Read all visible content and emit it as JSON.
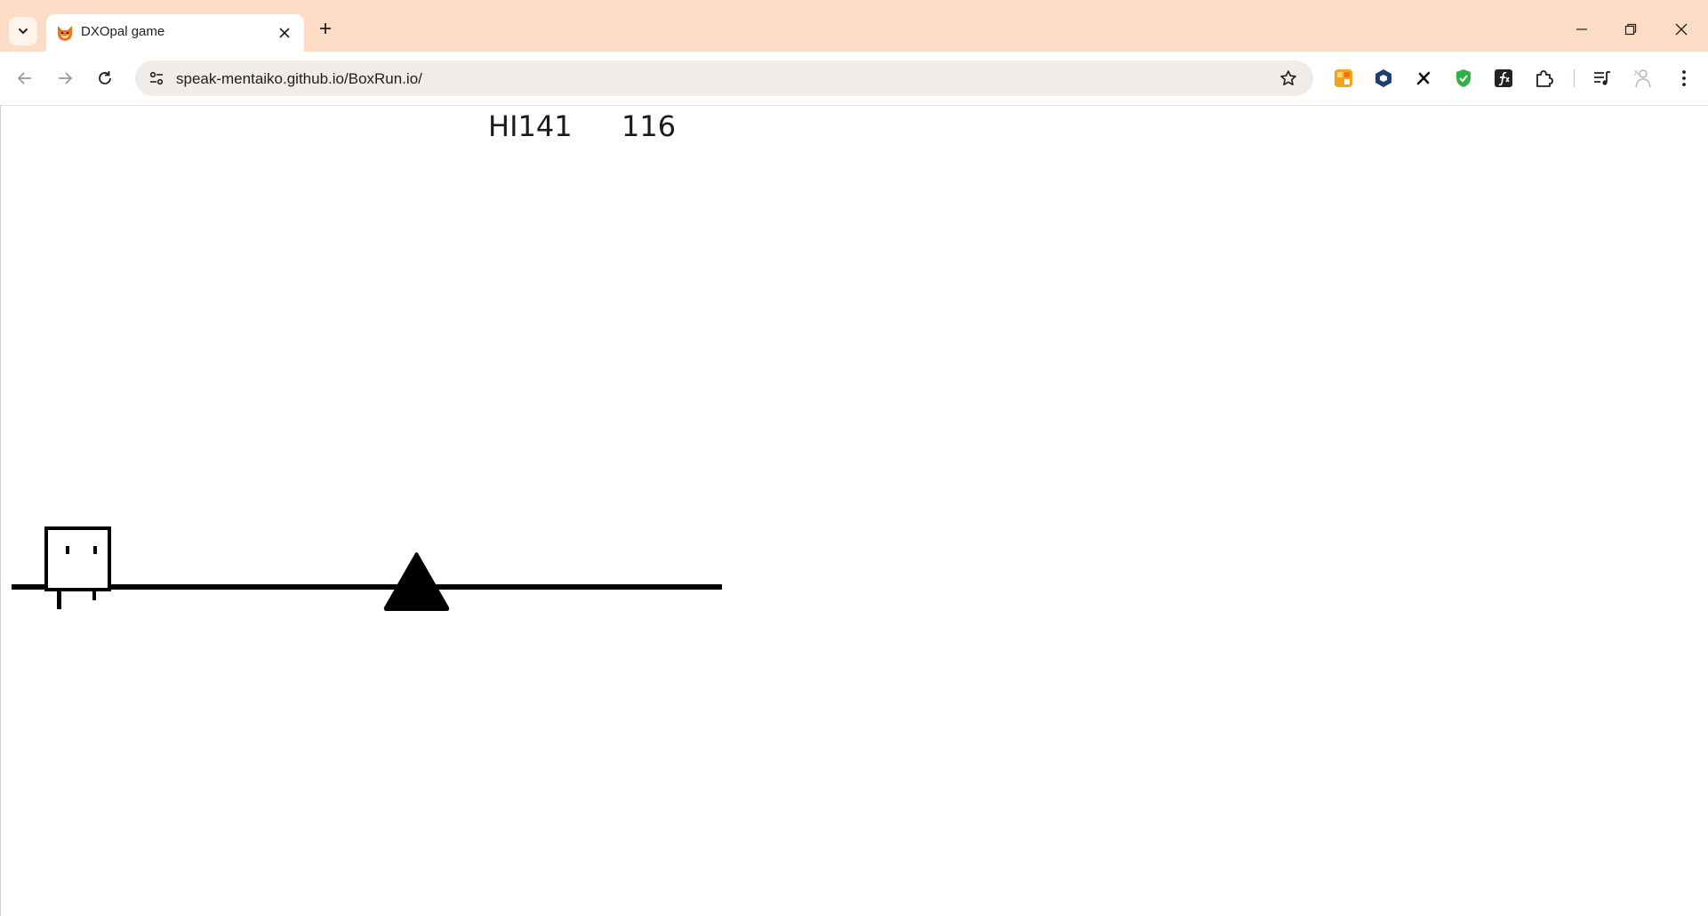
{
  "browser": {
    "tab": {
      "title": "DXOpal game",
      "favicon": "fox-icon"
    },
    "address_bar": {
      "url": "speak-mentaiko.github.io/BoxRun.io/"
    },
    "colors": {
      "tab_strip": "#fddcc6",
      "omnibox": "#f1ece9"
    },
    "extensions": [
      "color-grid-extension-icon",
      "shield-hex-extension-icon",
      "x-extension-icon",
      "green-shield-extension-icon",
      "fx-extension-icon",
      "puzzle-extensions-icon"
    ]
  },
  "game": {
    "hi_score": "HI141",
    "score": "116",
    "colors": {
      "ink": "#000000",
      "background": "#ffffff"
    },
    "objects": [
      "box-player",
      "ground-line",
      "triangle-spike"
    ]
  }
}
